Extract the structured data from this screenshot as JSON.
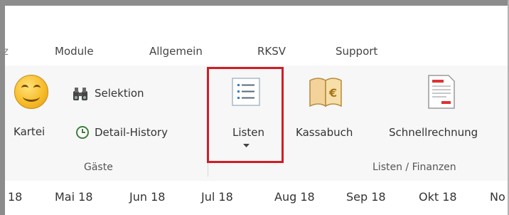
{
  "tabs": [
    "Module",
    "Allgemein",
    "RKSV",
    "Support"
  ],
  "ribbon": {
    "gaeste_group_label": "Gäste",
    "listen_group_label": "Listen / Finanzen",
    "kartei_label": "Kartei",
    "selektion_label": "Selektion",
    "detail_history_label": "Detail-History",
    "listen_label": "Listen",
    "kassabuch_label": "Kassabuch",
    "schnellrechnung_label": "Schnellrechnung"
  },
  "months": [
    "18",
    "Mai 18",
    "Jun 18",
    "Jul 18",
    "Aug 18",
    "Sep 18",
    "Okt 18",
    "No"
  ],
  "colors": {
    "highlight": "#d01d25",
    "ribbon_bg": "#f7f7f7"
  },
  "icons": [
    "smiley-icon",
    "binoculars-icon",
    "history-clock-icon",
    "list-icon",
    "book-euro-icon",
    "invoice-icon",
    "dropdown-arrow-icon"
  ]
}
